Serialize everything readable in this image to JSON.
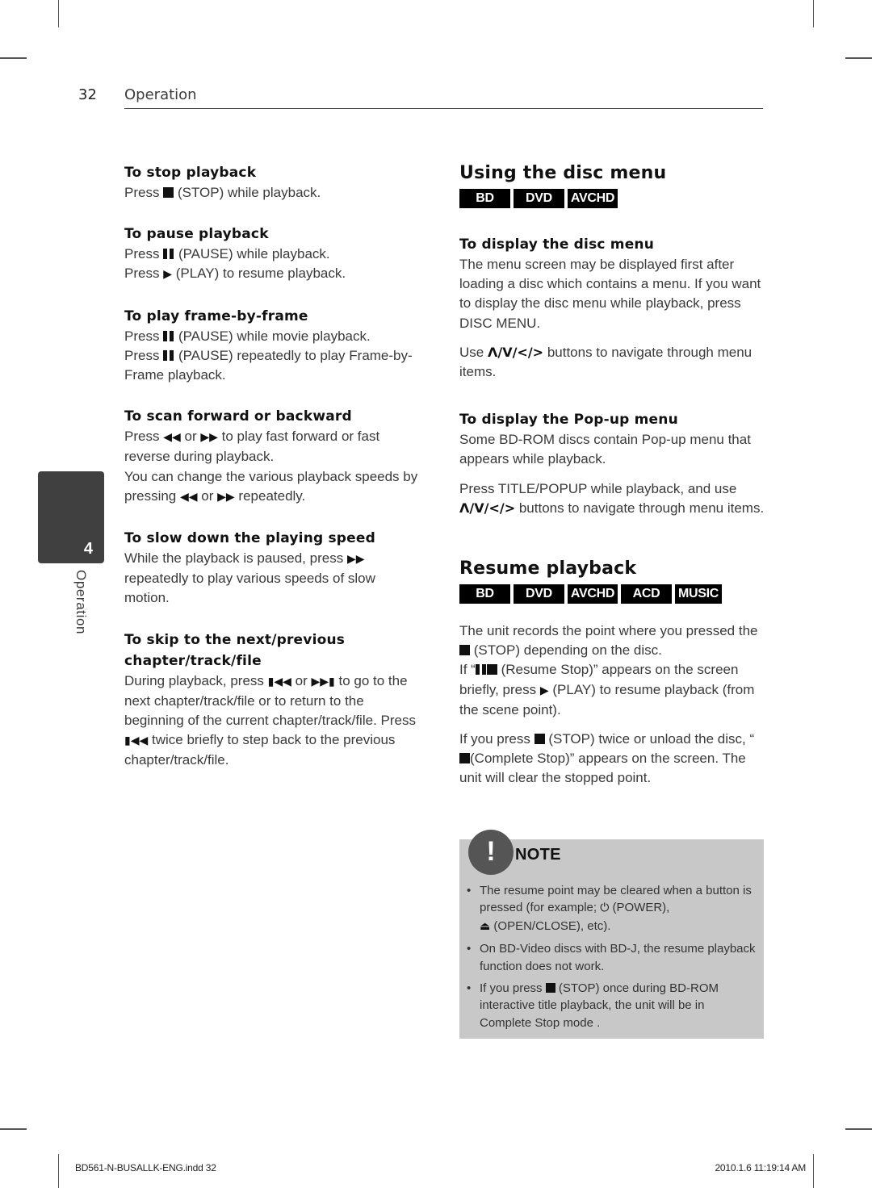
{
  "header": {
    "page_number": "32",
    "section": "Operation"
  },
  "chapter_tab": {
    "number": "4",
    "label": "Operation"
  },
  "left_column": {
    "stop": {
      "title": "To stop playback",
      "line1_pre": "Press",
      "line1_post": "(STOP) while playback."
    },
    "pause": {
      "title": "To pause playback",
      "line1_pre": "Press",
      "line1_post": "(PAUSE) while playback.",
      "line2_pre": "Press",
      "line2_post": "(PLAY) to resume playback."
    },
    "frame": {
      "title": "To play frame-by-frame",
      "line1_pre": "Press",
      "line1_post": "(PAUSE) while movie playback.",
      "line2_pre": "Press",
      "line2_post": "(PAUSE) repeatedly to play Frame-by-Frame playback."
    },
    "scan": {
      "title": "To scan forward or backward",
      "p1_pre": "Press",
      "p1_or": "or",
      "p1_post": "to play fast forward or fast reverse during playback.",
      "p2_pre": "You can change the various playback speeds by pressing",
      "p2_or": "or",
      "p2_post": "repeatedly."
    },
    "slow": {
      "title": "To slow down the playing speed",
      "p_pre": "While the playback is paused, press",
      "p_post": "repeatedly to play various speeds of slow motion."
    },
    "skip": {
      "title": "To skip to the next/previous chapter/track/file",
      "p1_pre": "During playback, press",
      "p1_or": "or",
      "p1_post": "to go to the next chapter/track/file or to return to the beginning of the current chapter/track/file.",
      "p2_pre": "Press",
      "p2_post": "twice briefly to step back to the previous chapter/track/file."
    }
  },
  "right_column": {
    "disc_menu": {
      "title": "Using the disc menu",
      "badges": [
        "BD",
        "DVD",
        "AVCHD"
      ],
      "display_title": "To display the disc menu",
      "display_p1": "The menu screen may be displayed first after loading a disc which contains a menu. If you want to display the disc menu while playback, press DISC MENU.",
      "display_p2_pre": "Use",
      "nav_symbols": "Λ/V/</>",
      "display_p2_post": "buttons to navigate through menu items.",
      "popup_title": "To display the Pop-up menu",
      "popup_p1": "Some BD-ROM discs contain Pop-up menu that appears while playback.",
      "popup_p2_pre": "Press TITLE/POPUP while playback, and use",
      "popup_p2_post": "buttons to navigate through menu items."
    },
    "resume": {
      "title": "Resume playback",
      "badges": [
        "BD",
        "DVD",
        "AVCHD",
        "ACD",
        "MUSIC"
      ],
      "p1_a": "The unit records the point where you pressed the",
      "p1_b": "(STOP) depending on the disc.",
      "p1_c": "If “",
      "p1_d": " (Resume Stop)” appears on the screen briefly, press",
      "p1_e": "(PLAY)  to resume playback (from the scene point).",
      "p2_a": "If you press",
      "p2_b": "(STOP) twice or unload the disc, “",
      "p2_c": "(Complete Stop)” appears on the screen. The unit will clear the stopped point."
    }
  },
  "note": {
    "title": "NOTE",
    "items": [
      {
        "a": "The resume point may be cleared when a button is pressed (for example;",
        "b": "(POWER),",
        "c": "(OPEN/CLOSE), etc)."
      },
      {
        "a": "On BD-Video discs with BD-J, the resume playback function does not work."
      },
      {
        "a": "If you press",
        "b": "(STOP) once during BD-ROM interactive title playback, the unit will be in Complete Stop mode ."
      }
    ]
  },
  "footer": {
    "file": "BD561-N-BUSALLK-ENG.indd   32",
    "date": "2010.1.6   11:19:14 AM"
  }
}
